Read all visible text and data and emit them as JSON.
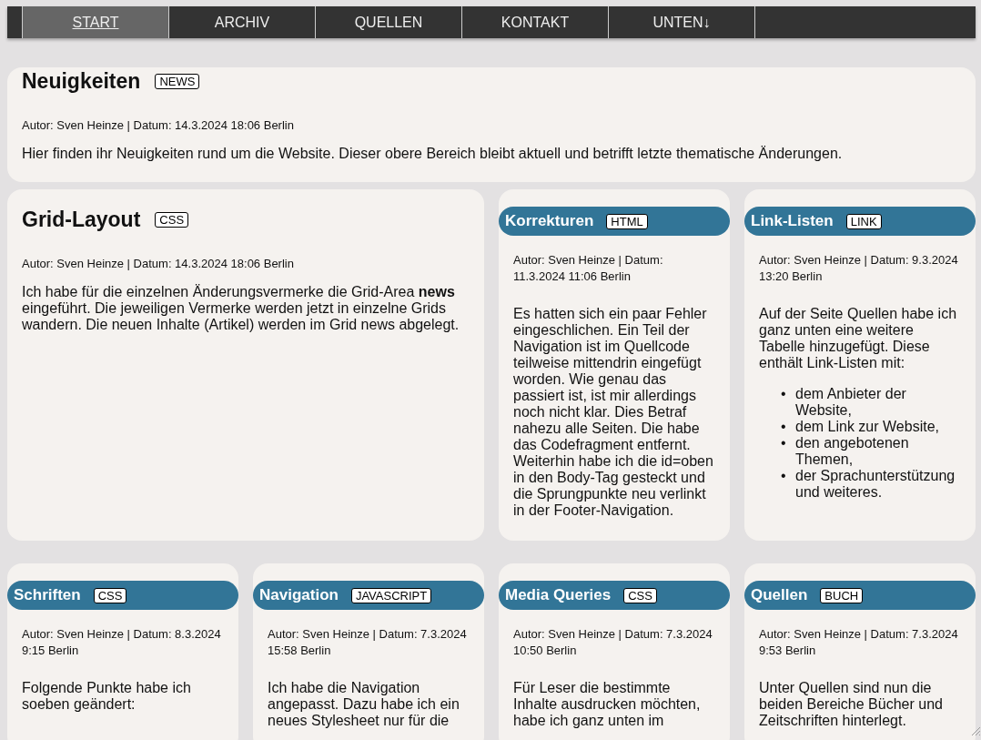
{
  "nav": {
    "items": [
      {
        "label": "START",
        "selected": true
      },
      {
        "label": "ARCHIV",
        "selected": false
      },
      {
        "label": "QUELLEN",
        "selected": false
      },
      {
        "label": "KONTAKT",
        "selected": false
      },
      {
        "label": "UNTEN↓",
        "selected": false
      }
    ]
  },
  "rows": [
    {
      "articles": [
        {
          "kind": "lead",
          "title": "Neuigkeiten",
          "tag": "NEWS",
          "meta": "Autor: Sven Heinze | Datum: 14.3.2024 18:06 Berlin",
          "body": [
            "Hier finden ihr Neuigkeiten rund um die Website. Dieser obere Bereich bleibt aktuell und betrifft letzte thematische Änderungen."
          ]
        }
      ]
    },
    {
      "articles": [
        {
          "kind": "feature",
          "title": "Grid-Layout",
          "tag": "CSS",
          "meta": "Autor: Sven Heinze | Datum: 14.3.2024 18:06 Berlin",
          "body": [
            "Ich habe für die einzelnen Änderungsvermerke die Grid-Area **news** eingeführt. Die jeweiligen Vermerke werden jetzt in einzelne Grids wandern. Die neuen Inhalte (Artikel) werden im Grid news abgelegt."
          ]
        },
        {
          "kind": "card",
          "title": "Korrekturen",
          "tag": "HTML",
          "meta": "Autor: Sven Heinze | Datum: 11.3.2024 11:06 Berlin",
          "body": [
            "Es hatten sich ein paar Fehler eingeschlichen. Ein Teil der Navigation ist im Quellcode teilweise mittendrin eingefügt worden. Wie genau das passiert ist, ist mir allerdings noch nicht klar. Dies Betraf nahezu alle Seiten. Die habe das Codefragment entfernt. Weiterhin habe ich die id=oben in den Body-Tag gesteckt und die Sprungpunkte neu verlinkt in der Footer-Navigation."
          ]
        },
        {
          "kind": "card",
          "title": "Link-Listen",
          "tag": "LINK",
          "meta": "Autor: Sven Heinze | Datum: 9.3.2024 13:20 Berlin",
          "body": [
            "Auf der Seite Quellen habe ich ganz unten eine weitere Tabelle hinzugefügt. Diese enthält Link-Listen mit:"
          ],
          "list_marker": "•",
          "list": [
            "dem Anbieter der Website,",
            "dem Link zur Website,",
            "den angebotenen Themen,",
            "der Sprachunterstützung und weiteres."
          ]
        }
      ]
    },
    {
      "articles": [
        {
          "kind": "card",
          "title": "Schriften",
          "tag": "CSS",
          "meta": "Autor: Sven Heinze | Datum: 8.3.2024 9:15 Berlin",
          "body": [
            "Folgende Punkte habe ich soeben geändert:"
          ]
        },
        {
          "kind": "card",
          "title": "Navigation",
          "tag": "JAVASCRIPT",
          "meta": "Autor: Sven Heinze | Datum: 7.3.2024 15:58 Berlin",
          "body": [
            "Ich habe die Navigation angepasst. Dazu habe ich ein neues Stylesheet nur für die"
          ]
        },
        {
          "kind": "card",
          "title": "Media Queries",
          "tag": "CSS",
          "meta": "Autor: Sven Heinze | Datum: 7.3.2024 10:50 Berlin",
          "body": [
            "Für Leser die bestimmte Inhalte ausdrucken möchten, habe ich ganz unten im"
          ]
        },
        {
          "kind": "card",
          "title": "Quellen",
          "tag": "BUCH",
          "meta": "Autor: Sven Heinze | Datum: 7.3.2024 9:53 Berlin",
          "body": [
            "Unter Quellen sind nun die beiden Bereiche Bücher und Zeitschriften hinterlegt."
          ]
        }
      ]
    }
  ]
}
